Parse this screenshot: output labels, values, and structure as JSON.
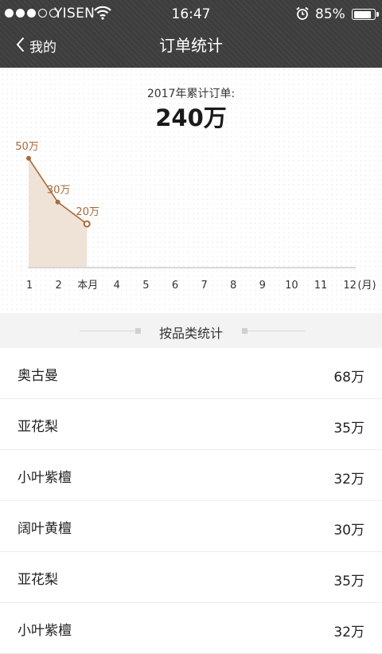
{
  "status_bar": {
    "carrier": "YISEN",
    "time": "16:47",
    "battery": "85%",
    "battery_level": 0.85
  },
  "nav": {
    "back_label": "我的",
    "title": "订单统计"
  },
  "summary": {
    "label": "2017年累计订单:",
    "value": "240万"
  },
  "chart_data": {
    "type": "area",
    "x_labels": [
      "1",
      "2",
      "本月",
      "4",
      "5",
      "6",
      "7",
      "8",
      "9",
      "10",
      "11",
      "12"
    ],
    "x_unit": "(月)",
    "series": [
      {
        "values": [
          50,
          30,
          20
        ],
        "data_labels": [
          "50万",
          "30万",
          "20万"
        ]
      }
    ],
    "ylim": [
      0,
      90
    ],
    "colors": {
      "line": "#a86a3a",
      "fill": "#efe2d7",
      "axis": "#d8d8d8"
    }
  },
  "category_section": {
    "title": "按品类统计",
    "items": [
      {
        "name": "奥古曼",
        "value": "68万"
      },
      {
        "name": "亚花梨",
        "value": "35万"
      },
      {
        "name": "小叶紫檀",
        "value": "32万"
      },
      {
        "name": "阔叶黄檀",
        "value": "30万"
      },
      {
        "name": "亚花梨",
        "value": "35万"
      },
      {
        "name": "小叶紫檀",
        "value": "32万"
      }
    ]
  }
}
